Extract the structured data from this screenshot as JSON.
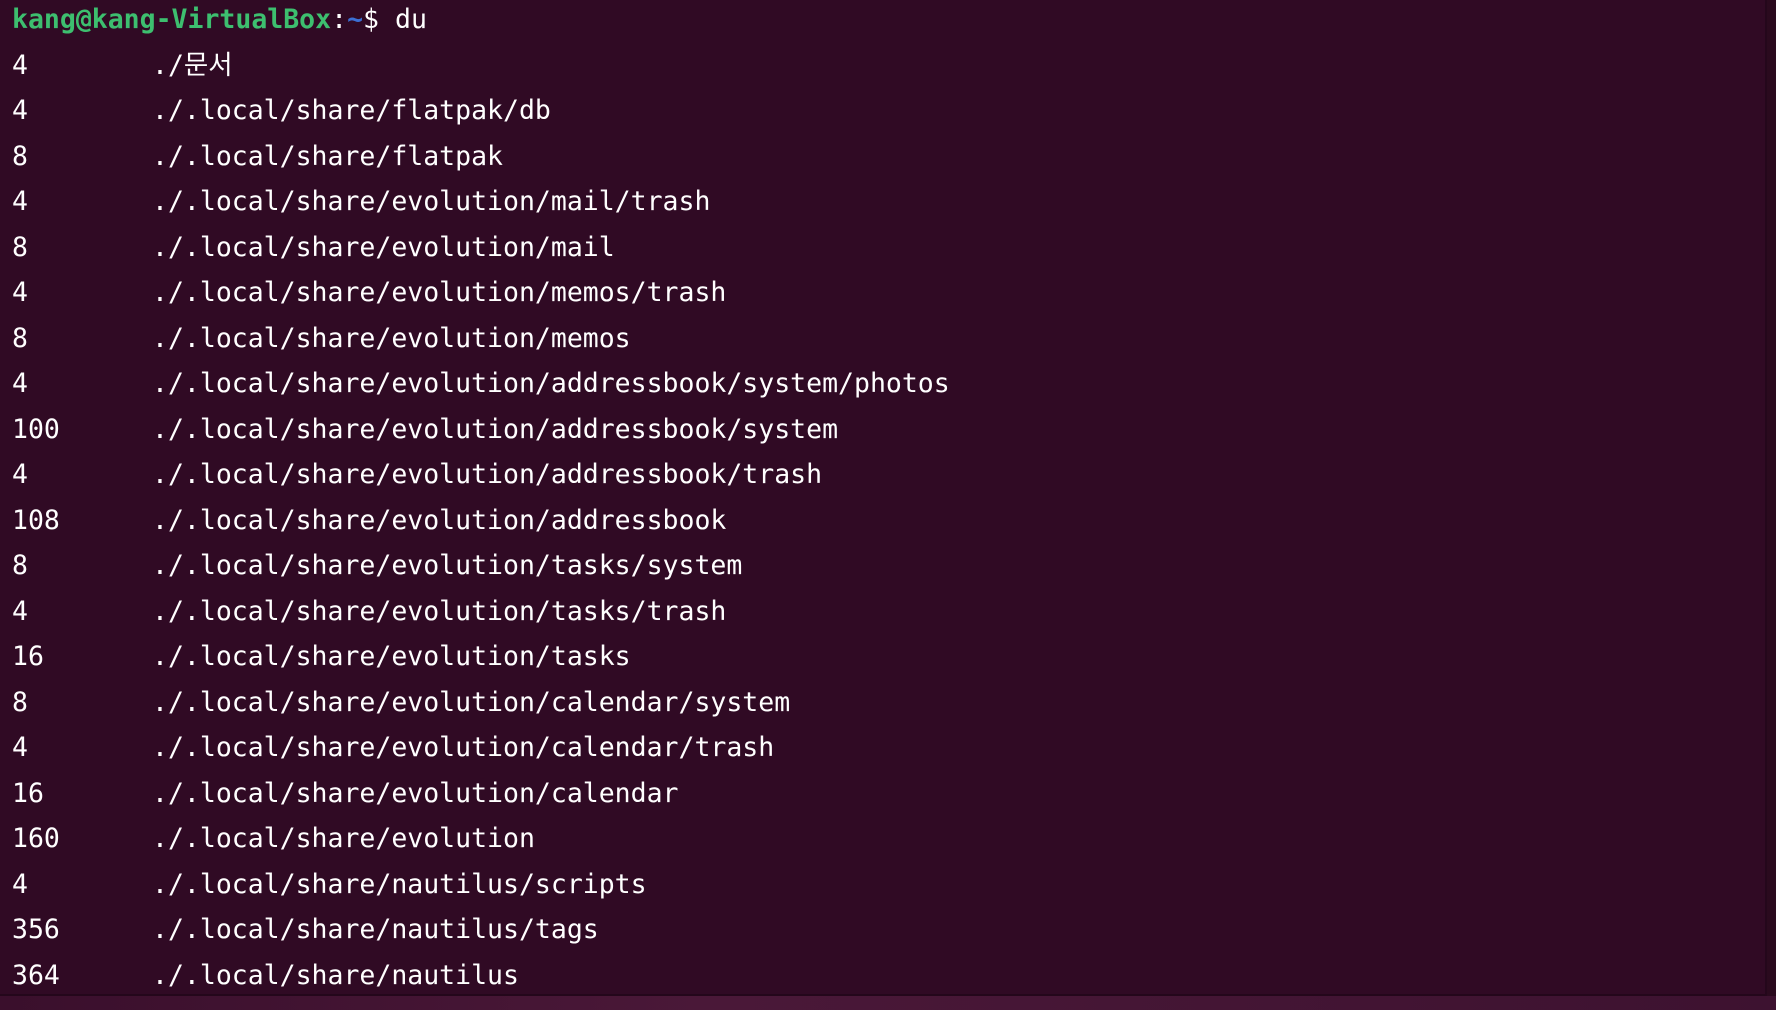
{
  "prompt": {
    "user_host": "kang@kang-VirtualBox",
    "colon": ":",
    "path": "~",
    "dollar": "$",
    "command": "du"
  },
  "output": [
    {
      "size": "4",
      "path": "./문서"
    },
    {
      "size": "4",
      "path": "./.local/share/flatpak/db"
    },
    {
      "size": "8",
      "path": "./.local/share/flatpak"
    },
    {
      "size": "4",
      "path": "./.local/share/evolution/mail/trash"
    },
    {
      "size": "8",
      "path": "./.local/share/evolution/mail"
    },
    {
      "size": "4",
      "path": "./.local/share/evolution/memos/trash"
    },
    {
      "size": "8",
      "path": "./.local/share/evolution/memos"
    },
    {
      "size": "4",
      "path": "./.local/share/evolution/addressbook/system/photos"
    },
    {
      "size": "100",
      "path": "./.local/share/evolution/addressbook/system"
    },
    {
      "size": "4",
      "path": "./.local/share/evolution/addressbook/trash"
    },
    {
      "size": "108",
      "path": "./.local/share/evolution/addressbook"
    },
    {
      "size": "8",
      "path": "./.local/share/evolution/tasks/system"
    },
    {
      "size": "4",
      "path": "./.local/share/evolution/tasks/trash"
    },
    {
      "size": "16",
      "path": "./.local/share/evolution/tasks"
    },
    {
      "size": "8",
      "path": "./.local/share/evolution/calendar/system"
    },
    {
      "size": "4",
      "path": "./.local/share/evolution/calendar/trash"
    },
    {
      "size": "16",
      "path": "./.local/share/evolution/calendar"
    },
    {
      "size": "160",
      "path": "./.local/share/evolution"
    },
    {
      "size": "4",
      "path": "./.local/share/nautilus/scripts"
    },
    {
      "size": "356",
      "path": "./.local/share/nautilus/tags"
    },
    {
      "size": "364",
      "path": "./.local/share/nautilus"
    }
  ]
}
